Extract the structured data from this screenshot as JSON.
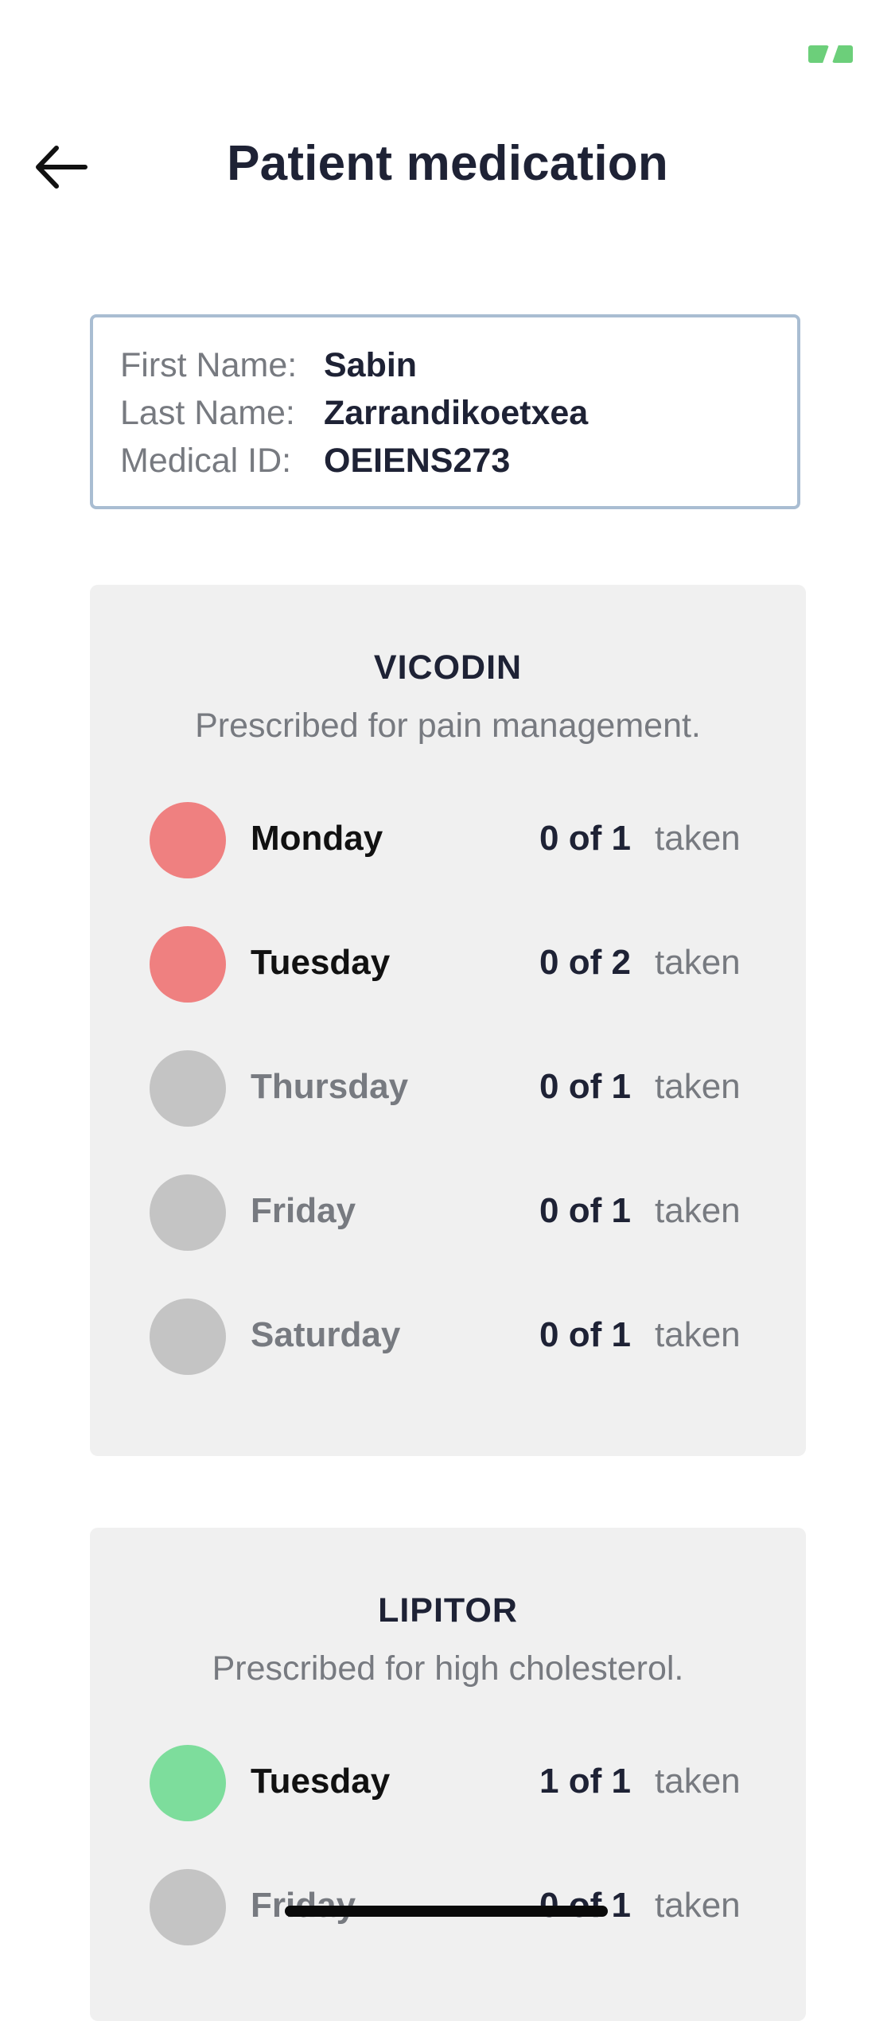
{
  "colors": {
    "missed": "#ef8080",
    "taken": "#7ddd9c",
    "upcoming": "#c4c4c4",
    "status_indicator": "#6ccf7a"
  },
  "header": {
    "title": "Patient medication",
    "back_icon": "arrow-left-icon"
  },
  "patient": {
    "first_name_label": "First Name:",
    "first_name": "Sabin",
    "last_name_label": "Last Name:",
    "last_name": "Zarrandikoetxea",
    "medical_id_label": "Medical ID:",
    "medical_id": "OEIENS273"
  },
  "medications": [
    {
      "name": "VICODIN",
      "description": "Prescribed for pain management.",
      "doses": [
        {
          "day": "Monday",
          "count": "0 of 1",
          "taken_label": "taken",
          "status": "missed"
        },
        {
          "day": "Tuesday",
          "count": "0 of 2",
          "taken_label": "taken",
          "status": "missed"
        },
        {
          "day": "Thursday",
          "count": "0 of 1",
          "taken_label": "taken",
          "status": "upcoming"
        },
        {
          "day": "Friday",
          "count": "0 of 1",
          "taken_label": "taken",
          "status": "upcoming"
        },
        {
          "day": "Saturday",
          "count": "0 of 1",
          "taken_label": "taken",
          "status": "upcoming"
        }
      ]
    },
    {
      "name": "LIPITOR",
      "description": "Prescribed for high cholesterol.",
      "doses": [
        {
          "day": "Tuesday",
          "count": "1 of 1",
          "taken_label": "taken",
          "status": "taken"
        },
        {
          "day": "Friday",
          "count": "0 of 1",
          "taken_label": "taken",
          "status": "upcoming"
        }
      ]
    }
  ]
}
